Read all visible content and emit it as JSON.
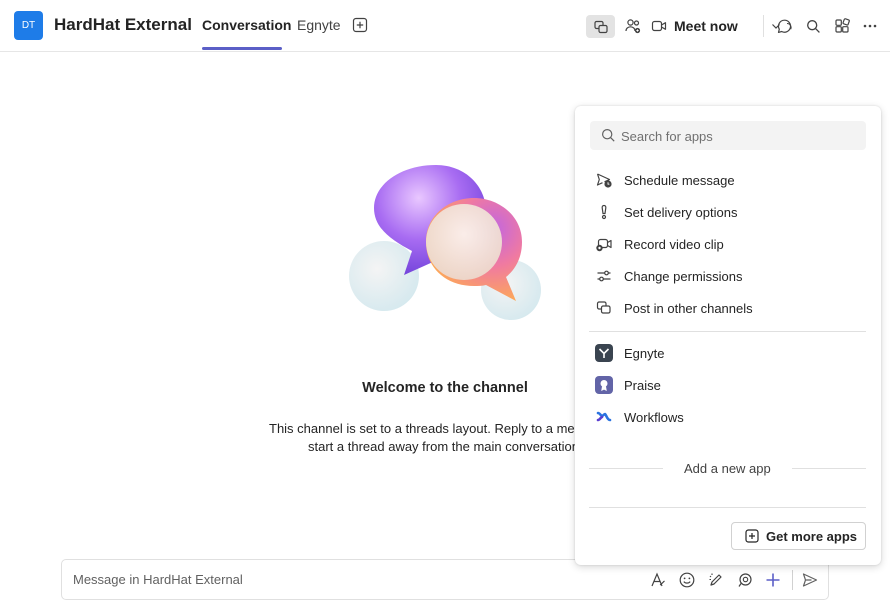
{
  "header": {
    "team_initials": "DT",
    "channel_name": "HardHat External",
    "tabs": [
      {
        "label": "Conversation",
        "active": true
      },
      {
        "label": "Egnyte",
        "active": false
      }
    ],
    "meet_now_label": "Meet now",
    "icons": [
      "apps-icon",
      "people-icon",
      "video-icon",
      "chevron-down-icon",
      "chat-icon",
      "search-icon",
      "extensions-icon",
      "more-icon"
    ]
  },
  "welcome": {
    "title": "Welcome to the channel",
    "line1": "This channel is set to a threads layout. Reply to a mes",
    "line2": "start a thread away from the main conversation"
  },
  "compose": {
    "placeholder": "Message in HardHat External"
  },
  "apps_flyout": {
    "search_placeholder": "Search for apps",
    "actions": [
      {
        "label": "Schedule message",
        "icon": "schedule-send-icon"
      },
      {
        "label": "Set delivery options",
        "icon": "priority-icon"
      },
      {
        "label": "Record video clip",
        "icon": "video-clip-icon"
      },
      {
        "label": "Change permissions",
        "icon": "sliders-icon"
      },
      {
        "label": "Post in other channels",
        "icon": "post-channels-icon"
      }
    ],
    "apps": [
      {
        "label": "Egnyte",
        "icon": "egnyte-icon",
        "color": "#3a4450"
      },
      {
        "label": "Praise",
        "icon": "praise-icon",
        "color": "#6264a7"
      },
      {
        "label": "Workflows",
        "icon": "workflows-icon",
        "color": "#2b73e0"
      }
    ],
    "add_new_app_label": "Add a new app",
    "get_more_apps_label": "Get more apps"
  },
  "colors": {
    "accent": "#5b5fc7",
    "team_avatar": "#1e7ce8"
  }
}
